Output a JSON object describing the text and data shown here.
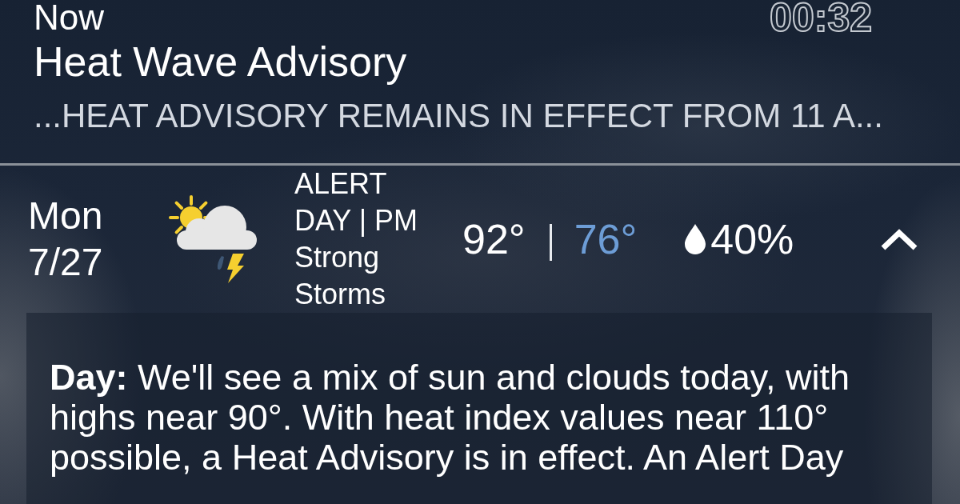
{
  "alert": {
    "time": "Now",
    "timer": "00:32",
    "title": "Heat Wave Advisory",
    "message": "...HEAT ADVISORY REMAINS IN EFFECT FROM 11 A..."
  },
  "forecast": {
    "day": "Mon",
    "date": "7/27",
    "condition": "ALERT DAY | PM Strong Storms",
    "high": "92°",
    "low": "76°",
    "precipitation": "40%",
    "expanded": true,
    "details": "**Day:** We'll see a mix of sun and clouds today, with highs near 90°. With heat index values near 110° possible, a Heat Advisory is in effect. An Alert Day"
  }
}
